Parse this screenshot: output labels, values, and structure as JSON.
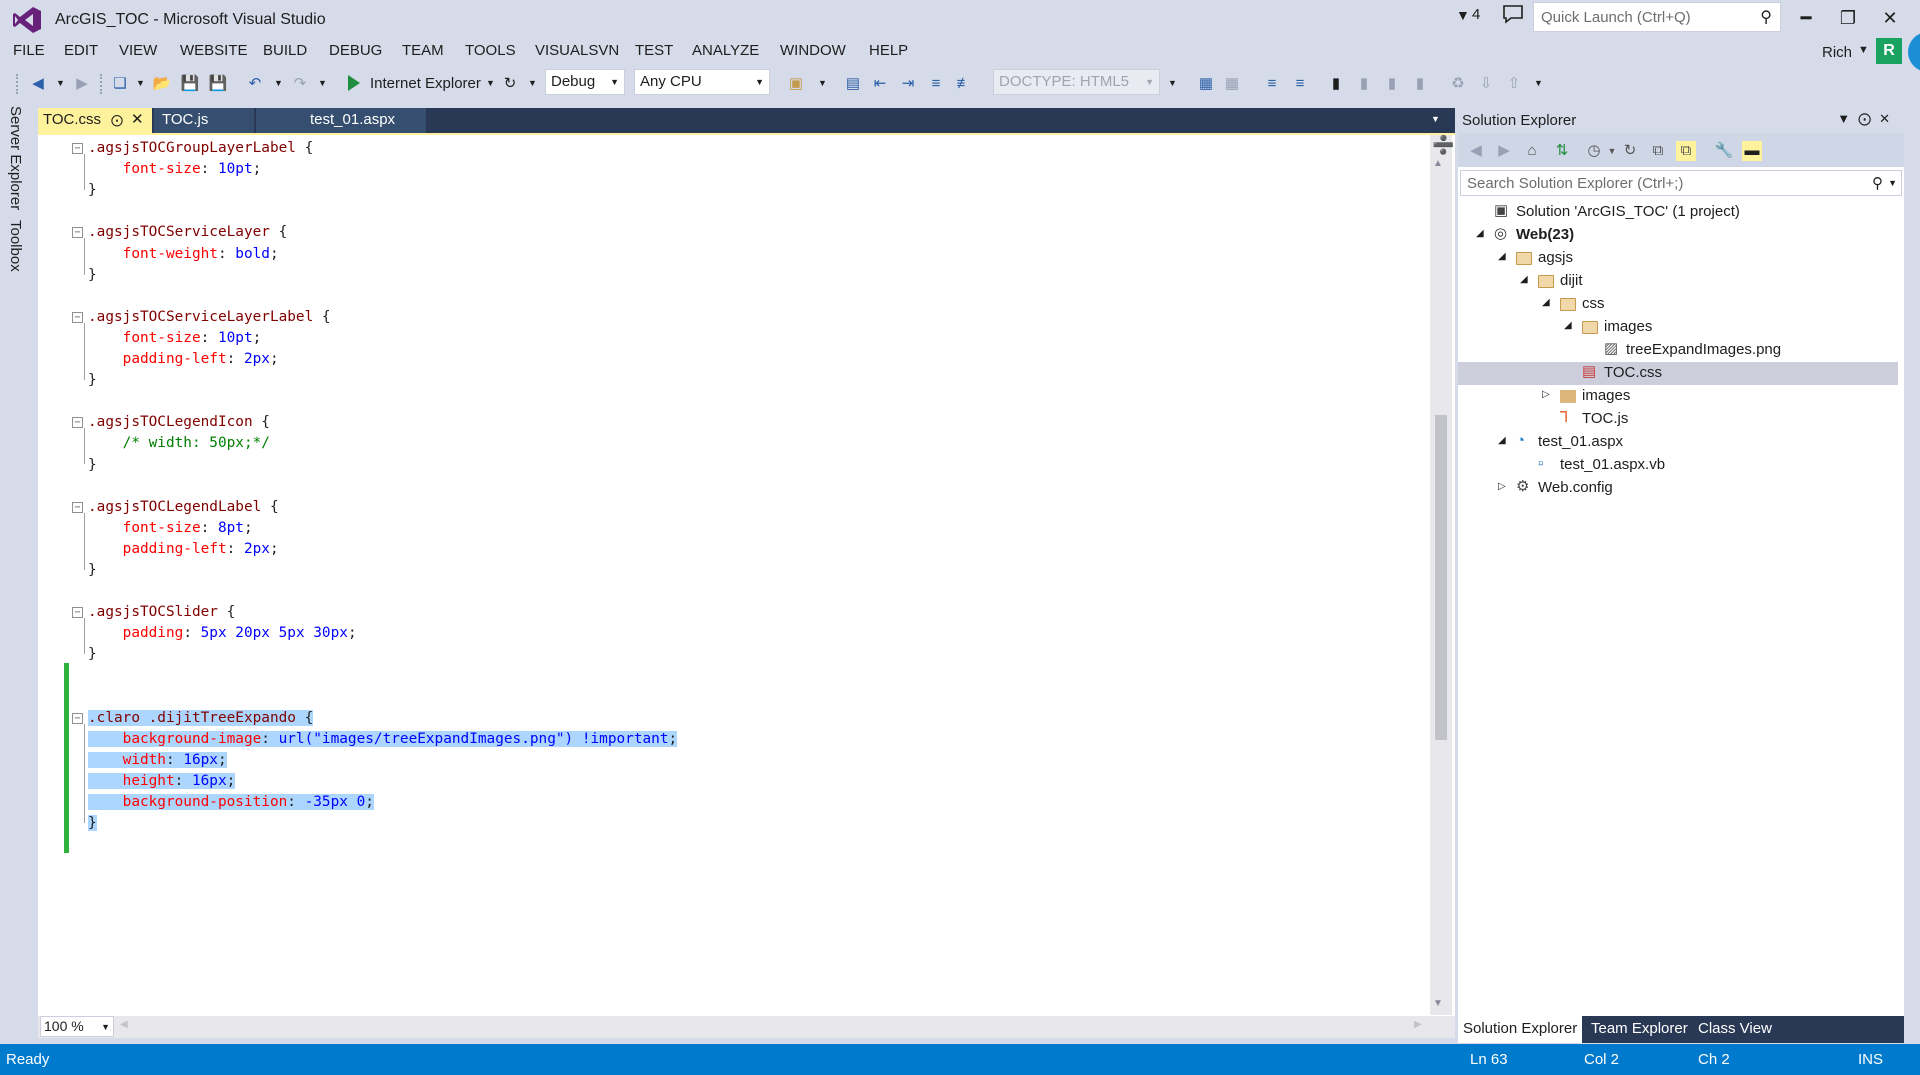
{
  "window": {
    "title": "ArcGIS_TOC - Microsoft Visual Studio",
    "notification_count": "4",
    "quick_launch_placeholder": "Quick Launch (Ctrl+Q)",
    "user": "Rich",
    "avatar_letter": "R"
  },
  "menu": [
    "FILE",
    "EDIT",
    "VIEW",
    "WEBSITE",
    "BUILD",
    "DEBUG",
    "TEAM",
    "TOOLS",
    "VISUALSVN",
    "TEST",
    "ANALYZE",
    "WINDOW",
    "HELP"
  ],
  "toolbar": {
    "run_label": "Internet Explorer",
    "configuration": "Debug",
    "platform": "Any CPU",
    "doctype": "DOCTYPE: HTML5"
  },
  "side_tabs": [
    "Server Explorer",
    "Toolbox"
  ],
  "document_tabs": [
    "TOC.css",
    "TOC.js",
    "test_01.aspx"
  ],
  "editor": {
    "zoom": "100 %",
    "lines": [
      [
        [
          "c-sel",
          ".agsjsTOCGroupLayerLabel"
        ],
        [
          "c-pun",
          " {"
        ]
      ],
      [
        [
          "c-prop",
          "    font-size"
        ],
        [
          "c-pun",
          ": "
        ],
        [
          "c-val",
          "10pt"
        ],
        [
          "c-pun",
          ";"
        ]
      ],
      [
        [
          "c-pun",
          "}"
        ]
      ],
      [],
      [
        [
          "c-sel",
          ".agsjsTOCServiceLayer"
        ],
        [
          "c-pun",
          " {"
        ]
      ],
      [
        [
          "c-prop",
          "    font-weight"
        ],
        [
          "c-pun",
          ": "
        ],
        [
          "c-val",
          "bold"
        ],
        [
          "c-pun",
          ";"
        ]
      ],
      [
        [
          "c-pun",
          "}"
        ]
      ],
      [],
      [
        [
          "c-sel",
          ".agsjsTOCServiceLayerLabel"
        ],
        [
          "c-pun",
          " {"
        ]
      ],
      [
        [
          "c-prop",
          "    font-size"
        ],
        [
          "c-pun",
          ": "
        ],
        [
          "c-val",
          "10pt"
        ],
        [
          "c-pun",
          ";"
        ]
      ],
      [
        [
          "c-prop",
          "    padding-left"
        ],
        [
          "c-pun",
          ": "
        ],
        [
          "c-val",
          "2px"
        ],
        [
          "c-pun",
          ";"
        ]
      ],
      [
        [
          "c-pun",
          "}"
        ]
      ],
      [],
      [
        [
          "c-sel",
          ".agsjsTOCLegendIcon"
        ],
        [
          "c-pun",
          " {"
        ]
      ],
      [
        [
          "c-cmt",
          "    /* width: 50px;*/"
        ]
      ],
      [
        [
          "c-pun",
          "}"
        ]
      ],
      [],
      [
        [
          "c-sel",
          ".agsjsTOCLegendLabel"
        ],
        [
          "c-pun",
          " {"
        ]
      ],
      [
        [
          "c-prop",
          "    font-size"
        ],
        [
          "c-pun",
          ": "
        ],
        [
          "c-val",
          "8pt"
        ],
        [
          "c-pun",
          ";"
        ]
      ],
      [
        [
          "c-prop",
          "    padding-left"
        ],
        [
          "c-pun",
          ": "
        ],
        [
          "c-val",
          "2px"
        ],
        [
          "c-pun",
          ";"
        ]
      ],
      [
        [
          "c-pun",
          "}"
        ]
      ],
      [],
      [
        [
          "c-sel",
          ".agsjsTOCSlider"
        ],
        [
          "c-pun",
          " {"
        ]
      ],
      [
        [
          "c-prop",
          "    padding"
        ],
        [
          "c-pun",
          ": "
        ],
        [
          "c-val",
          "5px 20px 5px 30px"
        ],
        [
          "c-pun",
          ";"
        ]
      ],
      [
        [
          "c-pun",
          "}"
        ]
      ],
      [],
      [],
      [
        [
          "c-sel",
          ".claro .dijitTreeExpando"
        ],
        [
          "c-pun",
          " {"
        ]
      ],
      [
        [
          "c-prop",
          "    background-image"
        ],
        [
          "c-pun",
          ": "
        ],
        [
          "c-val",
          "url(\"images/treeExpandImages.png\") !important"
        ],
        [
          "c-pun",
          ";"
        ]
      ],
      [
        [
          "c-prop",
          "    width"
        ],
        [
          "c-pun",
          ": "
        ],
        [
          "c-val",
          "16px"
        ],
        [
          "c-pun",
          ";"
        ]
      ],
      [
        [
          "c-prop",
          "    height"
        ],
        [
          "c-pun",
          ": "
        ],
        [
          "c-val",
          "16px"
        ],
        [
          "c-pun",
          ";"
        ]
      ],
      [
        [
          "c-prop",
          "    background-position"
        ],
        [
          "c-pun",
          ": "
        ],
        [
          "c-val",
          "-35px 0"
        ],
        [
          "c-pun",
          ";"
        ]
      ],
      [
        [
          "c-pun",
          "}"
        ]
      ]
    ]
  },
  "solution_explorer": {
    "title": "Solution Explorer",
    "search_placeholder": "Search Solution Explorer (Ctrl+;)",
    "tree": [
      {
        "label": "Solution 'ArcGIS_TOC' (1 project)",
        "icon": "solution-icon",
        "depth": 0,
        "expander": ""
      },
      {
        "label": "Web(23)",
        "icon": "web-project-icon",
        "depth": 0,
        "expander": "expanded",
        "bold": true
      },
      {
        "label": "agsjs",
        "icon": "folder-open-icon",
        "depth": 1,
        "expander": "expanded"
      },
      {
        "label": "dijit",
        "icon": "folder-open-icon",
        "depth": 2,
        "expander": "expanded"
      },
      {
        "label": "css",
        "icon": "folder-open-icon",
        "depth": 3,
        "expander": "expanded"
      },
      {
        "label": "images",
        "icon": "folder-open-icon",
        "depth": 4,
        "expander": "expanded"
      },
      {
        "label": "treeExpandImages.png",
        "icon": "image-file-icon",
        "depth": 5,
        "expander": ""
      },
      {
        "label": "TOC.css",
        "icon": "css-file-icon",
        "depth": 4,
        "expander": "",
        "selected": true
      },
      {
        "label": "images",
        "icon": "folder-icon",
        "depth": 3,
        "expander": "collapsed"
      },
      {
        "label": "TOC.js",
        "icon": "js-file-icon",
        "depth": 3,
        "expander": ""
      },
      {
        "label": "test_01.aspx",
        "icon": "aspx-file-icon",
        "depth": 1,
        "expander": "expanded"
      },
      {
        "label": "test_01.aspx.vb",
        "icon": "vb-file-icon",
        "depth": 2,
        "expander": ""
      },
      {
        "label": "Web.config",
        "icon": "config-file-icon",
        "depth": 1,
        "expander": "collapsed"
      }
    ],
    "bottom_tabs": [
      "Solution Explorer",
      "Team Explorer",
      "Class View"
    ]
  },
  "status": {
    "state": "Ready",
    "line": "Ln 63",
    "col": "Col 2",
    "ch": "Ch 2",
    "mode": "INS"
  },
  "colors": {
    "accent": "#007acc",
    "tab_active": "#fff29d",
    "selection": "#add6ff",
    "change_marker": "#2fb33e"
  }
}
